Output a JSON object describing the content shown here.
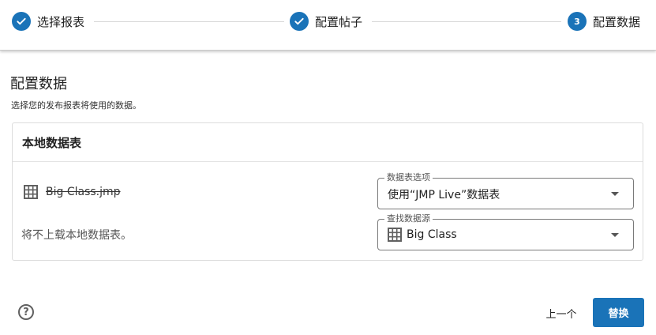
{
  "stepper": {
    "steps": [
      {
        "label": "选择报表",
        "state": "completed",
        "icon": "check-icon"
      },
      {
        "label": "配置帖子",
        "state": "completed",
        "icon": "check-icon"
      },
      {
        "label": "配置数据",
        "state": "active",
        "number": "3"
      }
    ]
  },
  "page": {
    "title": "配置数据",
    "subtitle": "选择您的发布报表将使用的数据。"
  },
  "card": {
    "title": "本地数据表",
    "data_table_name": "Big Class.jmp",
    "data_table_icon": "table-icon",
    "no_upload_text": "将不上载本地数据表。",
    "fields": {
      "table_option": {
        "legend": "数据表选项",
        "value": "使用“JMP Live”数据表"
      },
      "find_source": {
        "legend": "查找数据源",
        "value": "Big Class",
        "icon": "table-icon"
      }
    }
  },
  "footer": {
    "help_icon": "help-icon",
    "help_glyph": "?",
    "back_label": "上一个",
    "replace_label": "替换"
  },
  "colors": {
    "accent": "#1a73b8",
    "border": "#dcdcdc"
  }
}
